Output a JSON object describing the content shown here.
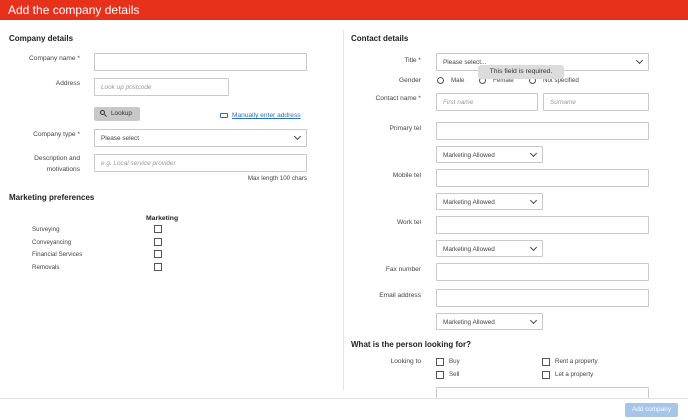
{
  "header": {
    "title": "Add the company details"
  },
  "company": {
    "section_title": "Company details",
    "name_label": "Company name *",
    "address_label": "Address",
    "postcode_placeholder": "Look up postcode",
    "lookup_label": "Lookup",
    "manual_link": "Manually enter address",
    "type_label": "Company type *",
    "type_value": "Please select",
    "desc_label_1": "Description and",
    "desc_label_2": "motivations",
    "desc_placeholder": "e.g. Local service provider",
    "max_length": "Max length 100 chars"
  },
  "marketing": {
    "section_title": "Marketing preferences",
    "column_header": "Marketing",
    "items": [
      {
        "label": "Surveying"
      },
      {
        "label": "Conveyancing"
      },
      {
        "label": "Financial Services"
      },
      {
        "label": "Removals"
      }
    ]
  },
  "contact": {
    "section_title": "Contact details",
    "title_label": "Title *",
    "title_value": "Please select...",
    "tooltip": "This field is required.",
    "gender_label": "Gender",
    "gender_options": [
      "Male",
      "Female",
      "Not specified"
    ],
    "contact_name_label": "Contact name *",
    "first_name_placeholder": "First name",
    "surname_placeholder": "Surname",
    "primary_tel_label": "Primary tel",
    "mobile_tel_label": "Mobile tel",
    "work_tel_label": "Work tel",
    "fax_label": "Fax number",
    "email_label": "Email address",
    "marketing_value": "Marketing Allowed"
  },
  "looking": {
    "section_title": "What is the person looking for?",
    "label": "Looking to",
    "options": [
      "Buy",
      "Sell",
      "Rent a property",
      "Let a property"
    ]
  },
  "footer": {
    "add_label": "Add company"
  }
}
